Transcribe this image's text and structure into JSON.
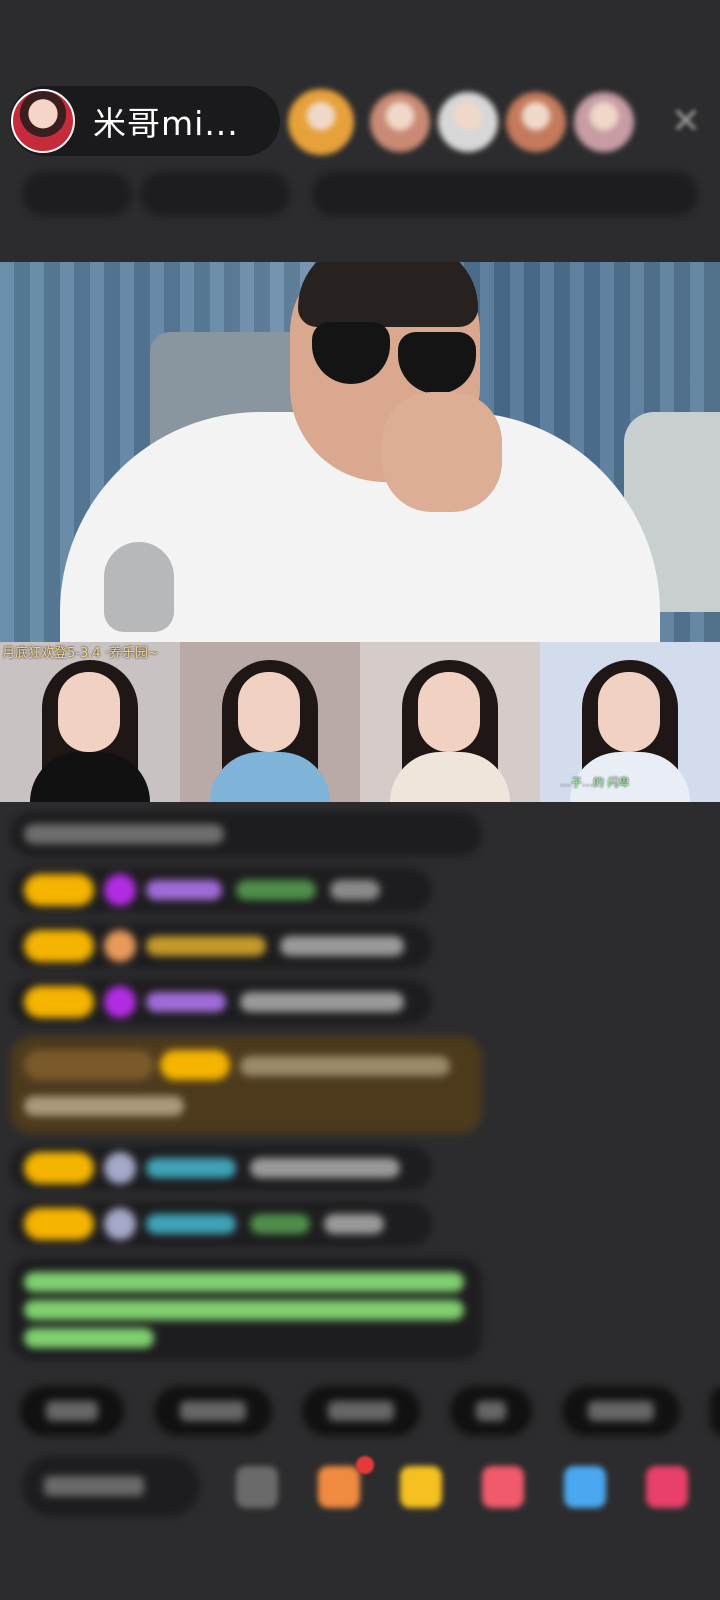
{
  "header": {
    "host_name": "米哥mi...",
    "close_glyph": "✕",
    "viewer_avatars": [
      "#e6a13a",
      "#c98a74",
      "#d7d7d7",
      "#c47a5c",
      "#c79ca4"
    ],
    "info_segment_colors": [
      "#8a7a3a",
      "#a8b8e8",
      "#e64a8a",
      "#2b3a1e",
      "#7a5ad8"
    ]
  },
  "video": {
    "thumbs": [
      {
        "caption": "月底狂欢登5-3.4 ·养乐园~",
        "bg": "#c9c2c3",
        "body": "#111",
        "sub": ""
      },
      {
        "caption": "",
        "bg": "#b9aaa7",
        "body": "#7fb4d8",
        "sub": ""
      },
      {
        "caption": "",
        "bg": "#d5cbc8",
        "body": "#efe5da",
        "sub": ""
      },
      {
        "caption": "",
        "bg": "#d2dcec",
        "body": "#e9eef6",
        "sub": "…子…的 闪卑"
      }
    ]
  },
  "chat": {
    "colors": {
      "level_badge": "#f5b400",
      "gem_purple": "#b32ce4",
      "name_purple": "#a06bd8",
      "name_green": "#4f8f4a",
      "name_teal": "#3ea3b6",
      "name_gold": "#c59a2a",
      "text_gray": "#9a9a9a",
      "highlight_bg": "#4d3a1c",
      "system_green": "#7fcf6f"
    }
  },
  "bottom": {
    "chip_widths": [
      104,
      118,
      118,
      82,
      118,
      30
    ],
    "icon_colors": [
      "#6a6a6a",
      "#f08a40",
      "#f5c020",
      "#f05a6a",
      "#4aa8f0",
      "#e8406a"
    ]
  }
}
